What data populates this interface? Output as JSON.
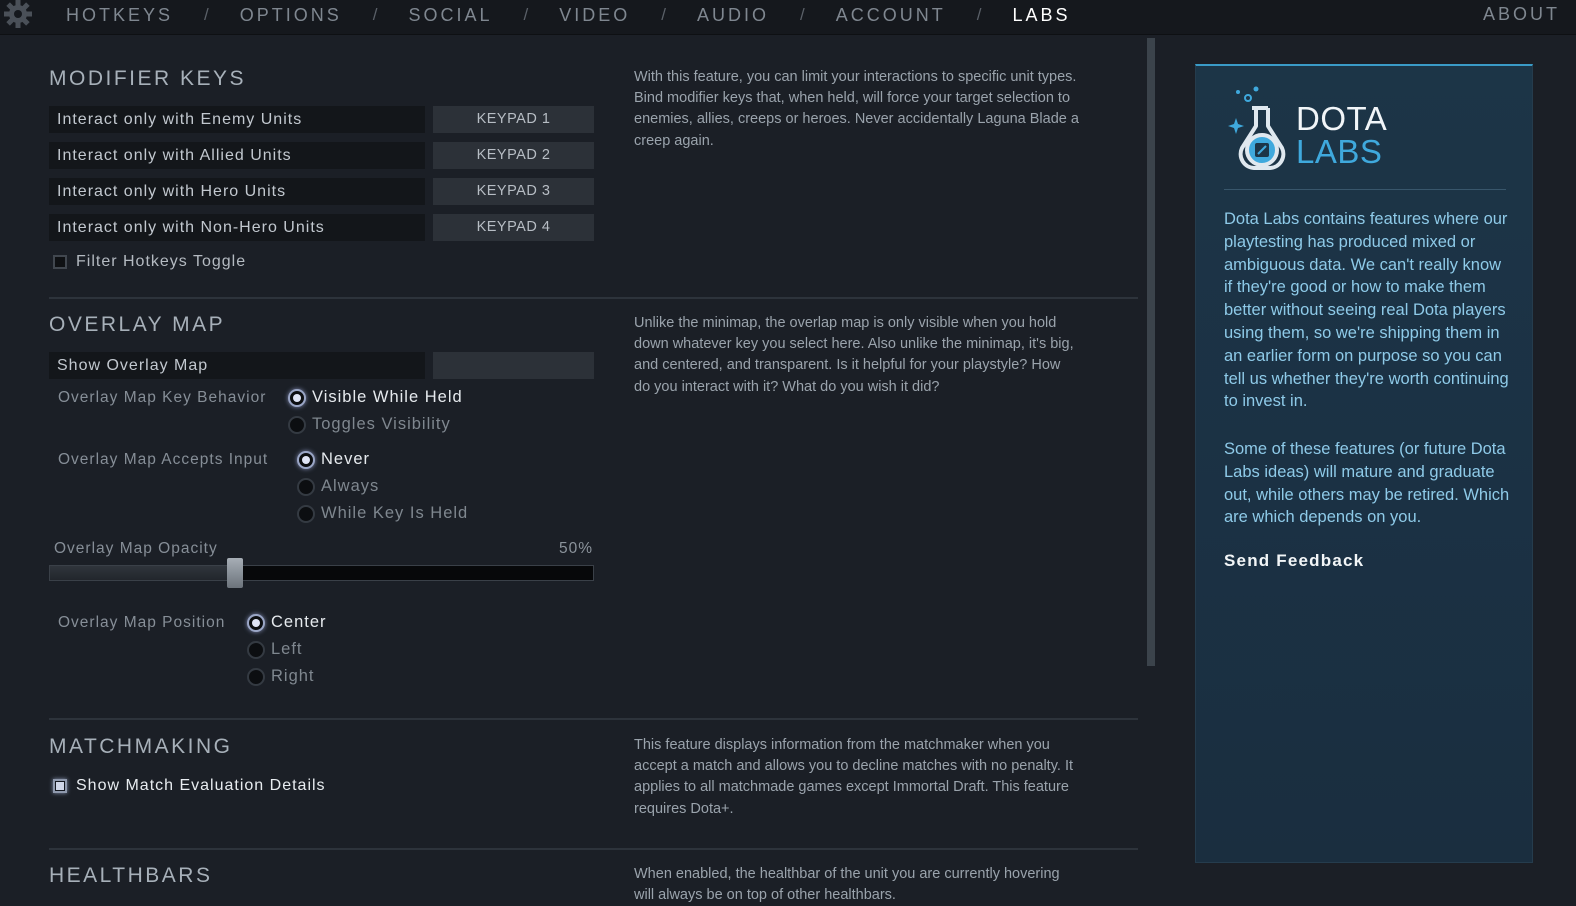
{
  "nav": {
    "items": [
      "HOTKEYS",
      "OPTIONS",
      "SOCIAL",
      "VIDEO",
      "AUDIO",
      "ACCOUNT",
      "LABS"
    ],
    "active": "LABS",
    "separator": "/",
    "about": "ABOUT"
  },
  "modifier_keys": {
    "title": "MODIFIER KEYS",
    "bindings": [
      {
        "label": "Interact only with Enemy Units",
        "key": "KEYPAD 1"
      },
      {
        "label": "Interact only with Allied Units",
        "key": "KEYPAD 2"
      },
      {
        "label": "Interact only with Hero Units",
        "key": "KEYPAD 3"
      },
      {
        "label": "Interact only with Non-Hero Units",
        "key": "KEYPAD 4"
      }
    ],
    "filter_toggle": {
      "label": "Filter Hotkeys Toggle",
      "checked": false
    },
    "description": "With this feature, you can limit your interactions to specific unit types. Bind modifier keys that, when held, will force your target selection to enemies, allies, creeps or heroes. Never accidentally Laguna Blade a creep again."
  },
  "overlay_map": {
    "title": "OVERLAY MAP",
    "show_label": "Show Overlay Map",
    "show_key": "",
    "key_behavior": {
      "label": "Overlay Map Key Behavior",
      "options": [
        "Visible While Held",
        "Toggles Visibility"
      ],
      "selected": 0
    },
    "accepts_input": {
      "label": "Overlay Map Accepts Input",
      "options": [
        "Never",
        "Always",
        "While Key Is Held"
      ],
      "selected": 0
    },
    "opacity": {
      "label": "Overlay Map Opacity",
      "value_text": "50%",
      "value": 0.34
    },
    "position": {
      "label": "Overlay Map Position",
      "options": [
        "Center",
        "Left",
        "Right"
      ],
      "selected": 0
    },
    "description": "Unlike the minimap, the overlap map is only visible when you hold down whatever key you select here. Also unlike the minimap, it's big, and centered, and transparent. Is it helpful for your playstyle? How do you interact with it? What do you wish it did?"
  },
  "matchmaking": {
    "title": "MATCHMAKING",
    "show_details": {
      "label": "Show Match Evaluation Details",
      "checked": true
    },
    "description": "This feature displays information from the matchmaker when you accept a match and allows you to decline matches with no penalty. It applies to all matchmade games except Immortal Draft. This feature requires Dota+."
  },
  "healthbars": {
    "title": "HEALTHBARS",
    "description": "When enabled, the healthbar of the unit you are currently hovering will always be on top of other healthbars."
  },
  "labs_panel": {
    "title_line1": "DOTA",
    "title_line2": "LABS",
    "paragraph1": "Dota Labs contains features where our playtesting has produced mixed or ambiguous data. We can't really know if they're good or how to make them better without seeing real Dota players using them, so we're shipping them in an earlier form on purpose so you can tell us whether they're worth continuing to invest in.",
    "paragraph2": "Some of these features (or future Dota Labs ideas) will mature and graduate out, while others may be retired. Which are which depends on you.",
    "feedback": "Send Feedback"
  },
  "colors": {
    "background": "#1b1f26",
    "accent": "#3fa9dd",
    "panel": "#1c3547"
  }
}
